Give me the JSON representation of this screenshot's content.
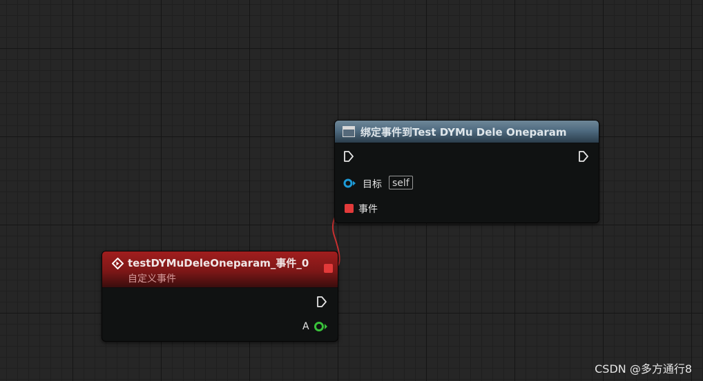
{
  "bind_node": {
    "title": "绑定事件到Test DYMu Dele Oneparam",
    "header_color": "#4f6b80",
    "icon": "function-icon",
    "pins": {
      "exec_in": "exec-pin",
      "exec_out": "exec-pin",
      "target_label": "目标",
      "target_default": "self",
      "event_label": "事件"
    }
  },
  "event_node": {
    "title": "testDYMuDeleOneparam_事件_0",
    "subtitle": "自定义事件",
    "header_color": "#8b1a1a",
    "icon": "event-icon",
    "pins": {
      "delegate_out": "delegate-pin",
      "exec_out": "exec-pin",
      "a_label": "A",
      "a_color": "#39c23a"
    }
  },
  "connection": {
    "from": "event_node.delegate_out",
    "to": "bind_node.event",
    "color": "#c83030"
  },
  "watermark": "CSDN @多方通行8"
}
